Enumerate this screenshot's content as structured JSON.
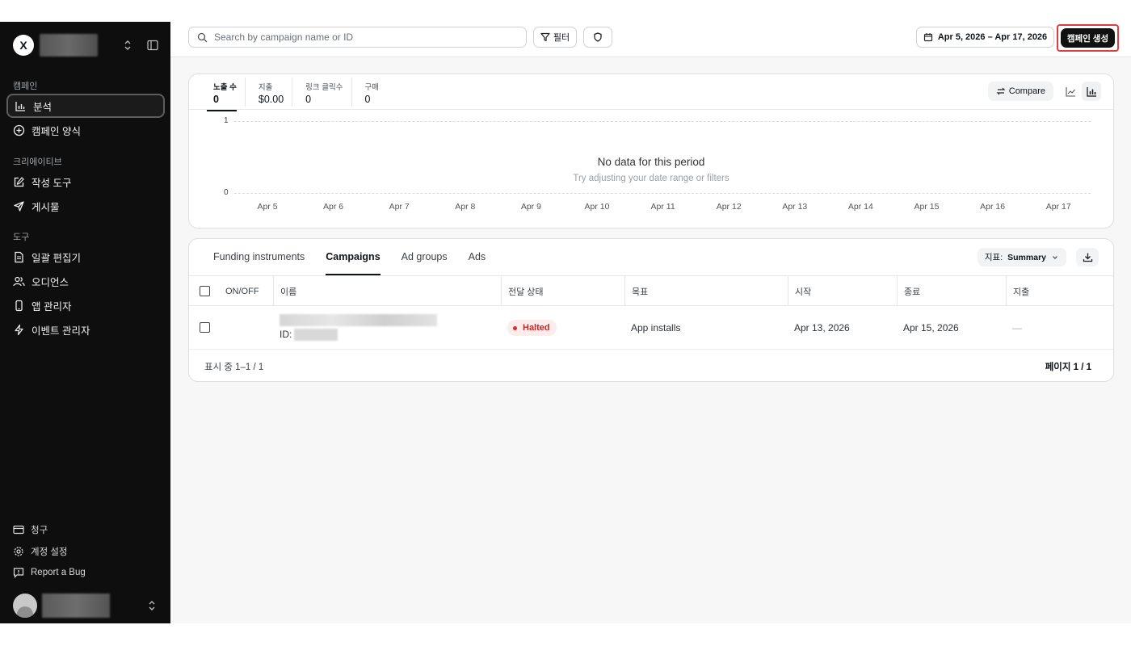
{
  "sidebar": {
    "logo": "X",
    "sections": [
      {
        "label": "캠페인",
        "items": [
          {
            "label": "분석",
            "icon": "bar-chart-icon"
          },
          {
            "label": "캠페인 양식",
            "icon": "plus-circle-icon"
          }
        ]
      },
      {
        "label": "크리에이티브",
        "items": [
          {
            "label": "작성 도구",
            "icon": "edit-icon"
          },
          {
            "label": "게시물",
            "icon": "send-icon"
          }
        ]
      },
      {
        "label": "도구",
        "items": [
          {
            "label": "일괄 편집기",
            "icon": "document-icon"
          },
          {
            "label": "오디언스",
            "icon": "users-icon"
          },
          {
            "label": "앱 관리자",
            "icon": "phone-icon"
          },
          {
            "label": "이벤트 관리자",
            "icon": "lightning-icon"
          }
        ]
      }
    ],
    "footer": [
      {
        "label": "청구",
        "icon": "card-icon"
      },
      {
        "label": "계정 설정",
        "icon": "gear-icon"
      },
      {
        "label": "Report a Bug",
        "icon": "alert-icon"
      }
    ]
  },
  "topbar": {
    "search_placeholder": "Search by campaign name or ID",
    "filter_label": "필터",
    "date_range": "Apr 5, 2026 – Apr 17, 2026",
    "create_label": "캠페인 생성"
  },
  "metrics": [
    {
      "label": "노출 수",
      "value": "0"
    },
    {
      "label": "지출",
      "value": "$0.00"
    },
    {
      "label": "링크 클릭수",
      "value": "0"
    },
    {
      "label": "구매",
      "value": "0"
    }
  ],
  "compare_label": "Compare",
  "chart_data": {
    "type": "line",
    "x": [
      "Apr 5",
      "Apr 6",
      "Apr 7",
      "Apr 8",
      "Apr 9",
      "Apr 10",
      "Apr 11",
      "Apr 12",
      "Apr 13",
      "Apr 14",
      "Apr 15",
      "Apr 16",
      "Apr 17"
    ],
    "yticks": [
      "1",
      "0"
    ],
    "ylim": [
      0,
      1
    ],
    "series": [],
    "empty_title": "No data for this period",
    "empty_subtitle": "Try adjusting your date range or filters"
  },
  "tabs": [
    "Funding instruments",
    "Campaigns",
    "Ad groups",
    "Ads"
  ],
  "metric_select": {
    "prefix": "지표:",
    "value": "Summary"
  },
  "table": {
    "columns": [
      "ON/OFF",
      "이름",
      "전달 상태",
      "목표",
      "시작",
      "종료",
      "지출"
    ],
    "rows": [
      {
        "id_label": "ID:",
        "status": "Halted",
        "objective": "App installs",
        "start": "Apr 13, 2026",
        "end": "Apr 15, 2026",
        "spend": "—"
      }
    ],
    "footer_left": "표시 중 1–1 / 1",
    "footer_right": "페이지 1 / 1"
  },
  "colors": {
    "accent": "#0f1419",
    "sidebar_bg": "#0e0e0e",
    "halted": "#c52626",
    "highlight": "#e23b3b"
  }
}
